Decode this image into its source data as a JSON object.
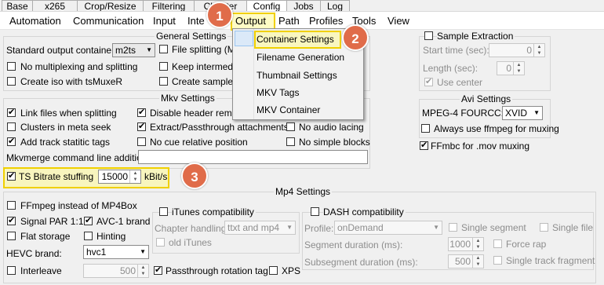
{
  "top_tabs": [
    "Base",
    "x265",
    "Crop/Resize",
    "Filtering",
    "Chapter",
    "Config",
    "Jobs",
    "Log"
  ],
  "sub_tabs": [
    "Automation",
    "Communication",
    "Input",
    "Inte",
    "Output",
    "Path",
    "Profiles",
    "Tools",
    "View"
  ],
  "menu": {
    "items": [
      "Container Settings",
      "Filename Generation",
      "Thumbnail Settings",
      "MKV Tags",
      "MKV Container"
    ]
  },
  "badges": [
    "1",
    "2",
    "3"
  ],
  "general": {
    "title": "General Settings",
    "std_container_label": "Standard output container:",
    "std_container_value": "m2ts",
    "file_splitting": "File splitting (Mi",
    "no_mux": "No multiplexing and splitting",
    "keep_intermediate": "Keep intermedia",
    "create_iso": "Create iso with tsMuxeR",
    "create_sample": "Create sample"
  },
  "sample_extraction": {
    "label": "Sample Extraction",
    "start_label": "Start time (sec):",
    "start_value": "0",
    "length_label": "Length (sec):",
    "length_value": "0",
    "use_center": "Use center"
  },
  "mkv": {
    "title": "Mkv Settings",
    "link_files": "Link files when splitting",
    "disable_header": "Disable header remov",
    "clusters": "Clusters in meta seek",
    "extract_passthrough": "Extract/Passthrough attachments",
    "no_audio_lacing": "No audio lacing",
    "add_track_tags": "Add track statitic tags",
    "no_cue": "No cue relative position",
    "no_simple_blocks": "No simple blocks",
    "mkvmerge_label": "Mkvmerge command line addition:"
  },
  "ts": {
    "label": "TS Bitrate stuffing",
    "value": "15000",
    "unit": "kBit/s"
  },
  "avi": {
    "title": "Avi Settings",
    "fourcc_label": "MPEG-4 FOURCC:",
    "fourcc_value": "XVID",
    "always_ffmpeg": "Always use ffmpeg for muxing",
    "ffmbc": "FFmbc for .mov muxing"
  },
  "mp4": {
    "title": "Mp4 Settings",
    "ffmpeg_instead": "FFmpeg instead of MP4Box",
    "signal_par": "Signal PAR 1:1",
    "avc1_brand": "AVC-1 brand",
    "flat_storage": "Flat storage",
    "hinting": "Hinting",
    "hevc_label": "HEVC brand:",
    "hevc_value": "hvc1",
    "interleave": "Interleave",
    "interleave_value": "500",
    "passthrough_rot": "Passthrough rotation tag",
    "xps": "XPS",
    "itunes": {
      "title": "iTunes compatibility",
      "chapter_label": "Chapter handling:",
      "chapter_value": "ttxt and mp4",
      "old_itunes": "old iTunes"
    },
    "dash": {
      "title": "DASH compatibility",
      "profile_label": "Profile:",
      "profile_value": "onDemand",
      "single_segment": "Single segment",
      "single_file": "Single file",
      "segment_label": "Segment duration (ms):",
      "segment_value": "1000",
      "force_rap": "Force rap",
      "subsegment_label": "Subsegment duration (ms):",
      "subsegment_value": "500",
      "single_track": "Single track fragment"
    }
  }
}
